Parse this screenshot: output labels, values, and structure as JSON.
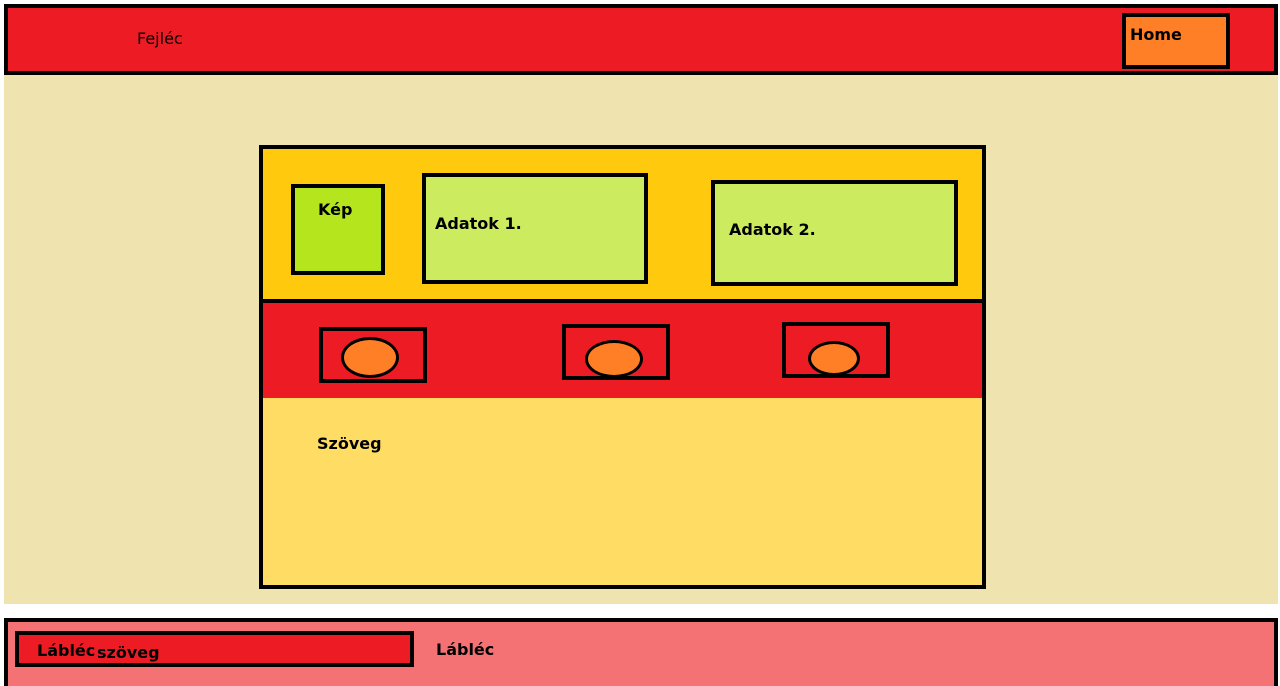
{
  "header": {
    "title": "Fejléc",
    "home_label": "Home"
  },
  "card": {
    "image_label": "Kép",
    "data1_label": "Adatok 1.",
    "data2_label": "Adatok 2.",
    "text_label": "Szöveg",
    "buttons_count_shown": "",
    "colors": {
      "top": "#ffc90e",
      "middle": "#ed1c24",
      "bottom": "#ffdc63",
      "image": "#b5e61d",
      "data": "#cdeb5f",
      "oval": "#ff7f27"
    }
  },
  "footer": {
    "box_label_left": "Lábléc",
    "box_label_right": "szöveg",
    "label": "Lábléc"
  },
  "colors": {
    "header": "#ed1c24",
    "body": "#efe4b0",
    "footer": "#f47274",
    "home": "#ff7f27"
  }
}
